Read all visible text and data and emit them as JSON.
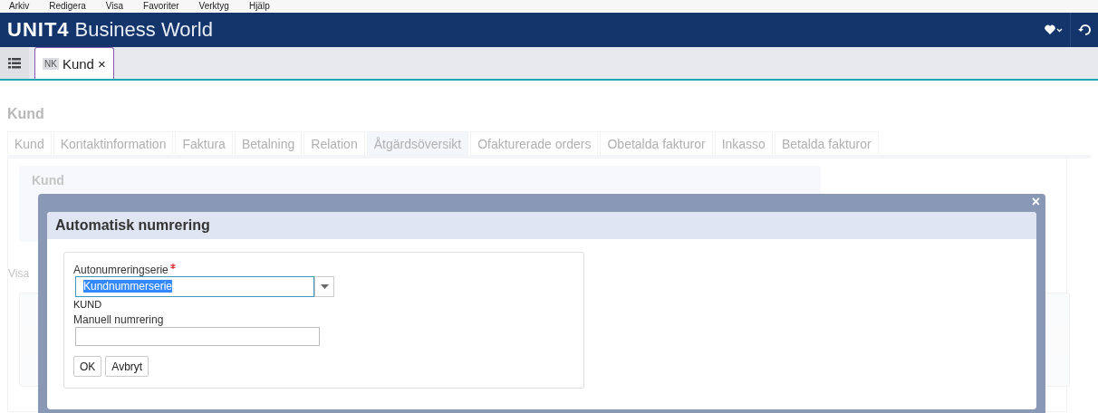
{
  "menu_bar": [
    "Arkiv",
    "Redigera",
    "Visa",
    "Favoriter",
    "Verktyg",
    "Hjälp"
  ],
  "header": {
    "logo": "UNIT4",
    "product": "Business World"
  },
  "document_tabs": [
    {
      "badge": "NK",
      "label": "Kund",
      "close": "×",
      "selected": true
    }
  ],
  "page": {
    "title": "Kund",
    "tabs": [
      {
        "label": "Kund",
        "selected": false
      },
      {
        "label": "Kontaktinformation",
        "selected": false
      },
      {
        "label": "Faktura",
        "selected": false
      },
      {
        "label": "Betalning",
        "selected": false
      },
      {
        "label": "Relation",
        "selected": false
      },
      {
        "label": "Åtgärdsöversikt",
        "selected": true
      },
      {
        "label": "Ofakturerade orders",
        "selected": false
      },
      {
        "label": "Obetalda fakturor",
        "selected": false
      },
      {
        "label": "Inkasso",
        "selected": false
      },
      {
        "label": "Betalda fakturor",
        "selected": false
      }
    ],
    "panel_title": "Kund",
    "section_label": "Visa"
  },
  "dialog": {
    "close": "×",
    "title": "Automatisk numrering",
    "series_label": "Autonumreringserie",
    "series_required": true,
    "series_value": "Kundnummerserie",
    "series_hint": "KUND",
    "manual_label": "Manuell numrering",
    "buttons": [
      "OK",
      "Avbryt"
    ]
  }
}
